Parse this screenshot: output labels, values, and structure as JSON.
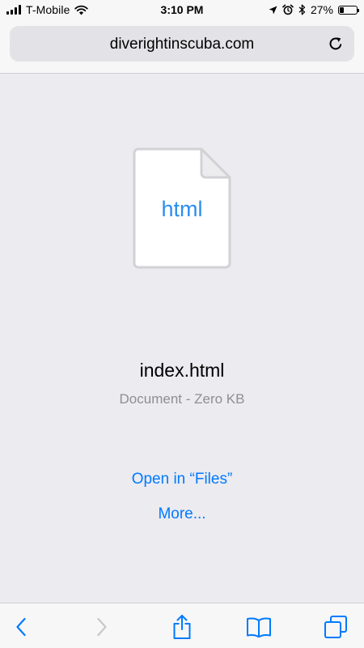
{
  "status_bar": {
    "carrier": "T-Mobile",
    "time": "3:10 PM",
    "battery_percent_label": "27%",
    "battery_level": 0.27,
    "signal_bars": 4,
    "icons": [
      "cellular-signal-icon",
      "wifi-icon",
      "location-arrow-icon",
      "alarm-icon",
      "bluetooth-icon",
      "battery-icon"
    ]
  },
  "address_bar": {
    "url": "diverightinscuba.com",
    "reload_icon": "reload-icon"
  },
  "document": {
    "file_type_label": "html",
    "file_name": "index.html",
    "file_info": "Document - Zero KB",
    "icon": "document-file-icon"
  },
  "actions": {
    "open_in_files": "Open in “Files”",
    "more": "More..."
  },
  "toolbar": {
    "buttons": [
      {
        "icon": "back-chevron-icon",
        "enabled": true
      },
      {
        "icon": "forward-chevron-icon",
        "enabled": false
      },
      {
        "icon": "share-icon",
        "enabled": true
      },
      {
        "icon": "bookmarks-icon",
        "enabled": true
      },
      {
        "icon": "tabs-icon",
        "enabled": true
      }
    ]
  },
  "colors": {
    "accent": "#007aff",
    "content_background": "#ebebf0",
    "secondary_text": "#8e8e93",
    "disabled": "#c7c7cc"
  }
}
